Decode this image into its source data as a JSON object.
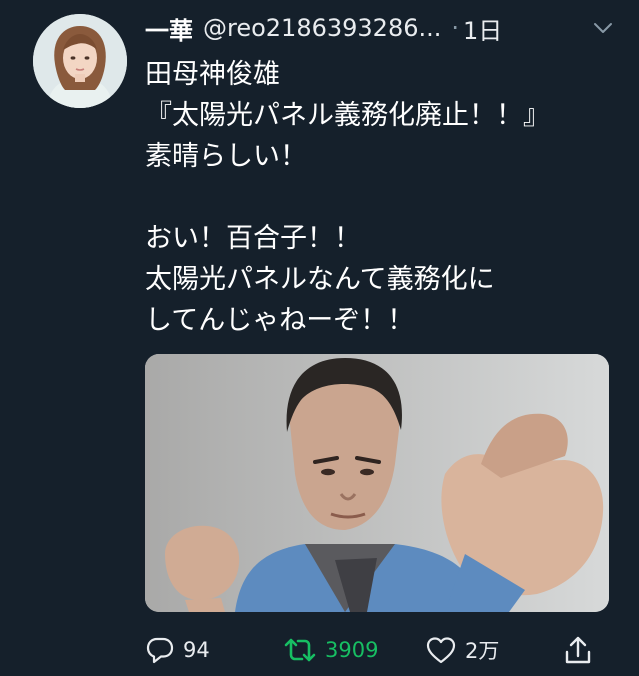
{
  "tweet": {
    "display_name": "一華",
    "handle": "@reo2186393286...",
    "separator": "·",
    "time": "1日",
    "lines": [
      "田母神俊雄",
      "『太陽光パネル義務化廃止！！』",
      "素晴らしい！",
      "",
      "おい！百合子！！",
      "太陽光パネルなんて義務化に",
      "してんじゃねーぞ！！"
    ],
    "replies": "94",
    "retweets": "3909",
    "likes": "2万"
  },
  "icons": {
    "caret": "chevron-down-icon",
    "reply": "reply-icon",
    "retweet": "retweet-icon",
    "like": "heart-icon",
    "share": "share-icon"
  },
  "colors": {
    "background": "#15202b",
    "retweet_active": "#17bf63",
    "secondary_text": "#8899a6"
  }
}
